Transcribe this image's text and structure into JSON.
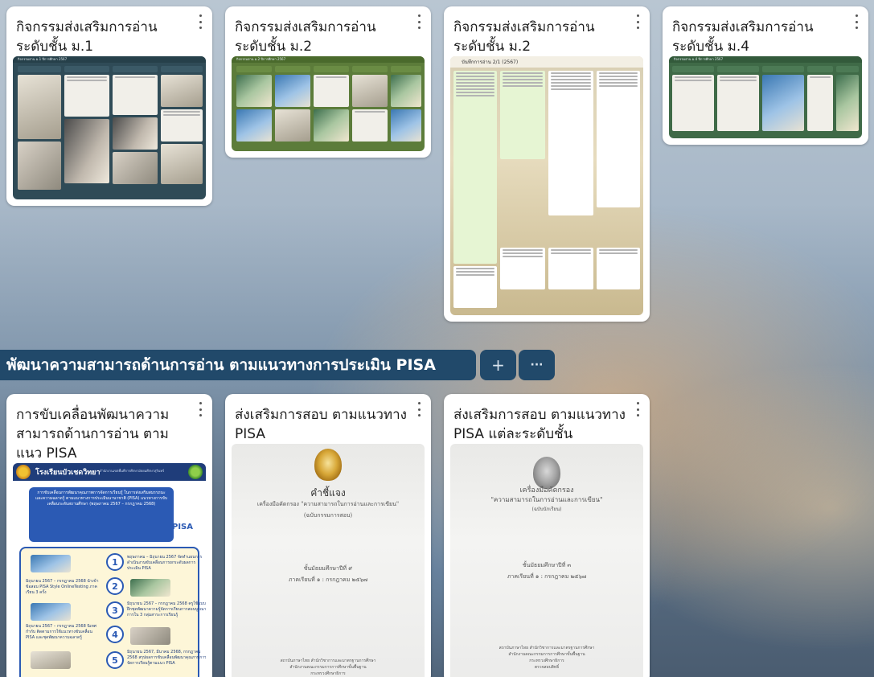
{
  "top_cards": [
    {
      "title": "กิจกรรมส่งเสริมการอ่าน ระดับชั้น ม.1",
      "thumb_header": "กิจกรรมอ่าน ม.1 ปีการศึกษา 2567"
    },
    {
      "title": "กิจกรรมส่งเสริมการอ่าน ระดับชั้น ม.2",
      "thumb_header": "กิจกรรมอ่าน ม.2 ปีการศึกษา 2567"
    },
    {
      "title": "กิจกรรมส่งเสริมการอ่าน ระดับชั้น ม.2",
      "thumb_header": "บันทึกการอ่าน 2/1 (2567)"
    },
    {
      "title": "กิจกรรมส่งเสริมการอ่าน ระดับชั้น ม.4",
      "thumb_header": "กิจกรรมอ่าน ม.4 ปีการศึกษา 2567"
    }
  ],
  "section": {
    "title": "พัฒนาความสามารถด้านการอ่าน ตามแนวทางการประเมิน PISA",
    "add_label": "+",
    "more_label": "···"
  },
  "bottom_cards": [
    {
      "title": "การขับเคลื่อนพัฒนาความสามารถด้านการอ่าน ตามแนว PISA",
      "infographic": {
        "school": "โรงเรียนบัวเชดวิทยา",
        "sub": "สำนักงานเขตพื้นที่การศึกษามัธยมศึกษาสุรินทร์",
        "headline": "การขับเคลื่อนการพัฒนาคุณภาพการจัดการเรียนรู้ ในการส่งเสริมสมรรถนะและความฉลาดรู้ ตามแนวทางการประเมินนานาชาติ (PISA) แนวทางการขับเคลื่อนระดับสถานศึกษา (พฤษภาคม 2567 – กรกฎาคม 2568)",
        "pisa": "PISA",
        "steps": [
          {
            "num": "1",
            "text": "พฤษภาคม – มิถุนายน 2567 จัดทำแผนการดำเนินงานขับเคลื่อนการยกระดับผลการประเมิน PISA"
          },
          {
            "num": "2",
            "text": "มิถุนายน 2567 – กรกฎาคม 2568 นำเข้าข้อสอบ PISA Style OnlineTesting ภาคเรียน 3 ครั้ง"
          },
          {
            "num": "3",
            "text": "มิถุนายน 2567 – กรกฎาคม 2568 ครูใช้แบบฝึกชุดพัฒนาความรู้จัดการเรียนการสอนบูรณาการใน 3 กลุ่มสาระการเรียนรู้"
          },
          {
            "num": "4",
            "text": "มิถุนายน 2567 – กรกฎาคม 2568 นิเทศ กำกับ ติดตามการใช้แนวทางขับเคลื่อน PISA และชุดพัฒนาความฉลาดรู้"
          },
          {
            "num": "5",
            "text": "มิถุนายน 2567, มีนาคม 2568, กรกฎาคม 2568 สรุปผลการขับเคลื่อนพัฒนาคุณภาพการจัดการเรียนรู้ตามแนว PISA"
          }
        ]
      }
    },
    {
      "title": "ส่งเสริมการสอบ ตามแนวทาง PISA",
      "scan": {
        "heading": "คำชี้แจง",
        "line1": "เครื่องมือคัดกรอง \"ความสามารถในการอ่านและการเขียน\"",
        "line2": "(ฉบับกรรมการสอบ)",
        "line3": "ชั้นมัธยมศึกษาปีที่ ๙",
        "line4": "ภาคเรียนที่ ๑ : กรกฎาคม ๒๕๖๗",
        "footer1": "สถาบันภาษาไทย สำนักวิชาการและมาตรฐานการศึกษา",
        "footer2": "สำนักงานคณะกรรมการการศึกษาขั้นพื้นฐาน",
        "footer3": "กระทรวงศึกษาธิการ"
      }
    },
    {
      "title": "ส่งเสริมการสอบ ตามแนวทาง PISA แต่ละระดับชั้น",
      "scan": {
        "line1": "เครื่องมือคัดกรอง",
        "line1b": "\"ความสามารถในการอ่านและการเขียน\"",
        "line2": "(ฉบับนักเรียน)",
        "line3": "ชั้นมัธยมศึกษาปีที่ ๓",
        "line4": "ภาคเรียนที่ ๑ : กรกฎาคม ๒๕๖๗",
        "footer1": "สถาบันภาษาไทย สำนักวิชาการและมาตรฐานการศึกษา",
        "footer2": "สำนักงานคณะกรรมการการศึกษาขั้นพื้นฐาน",
        "footer3": "กระทรวงศึกษาธิการ",
        "footer4": "ตรวจสอบสิทธิ์"
      }
    }
  ],
  "colors": {
    "section_bar": "#21496a",
    "card_bg": "#ffffff",
    "board_bg": "#2f4b57",
    "accent_orange": "#d97a00",
    "pisa_blue": "#2b5ab4"
  },
  "icons": [
    "kebab-menu-icon",
    "plus-icon",
    "ellipsis-icon",
    "emblem-seal-icon"
  ]
}
